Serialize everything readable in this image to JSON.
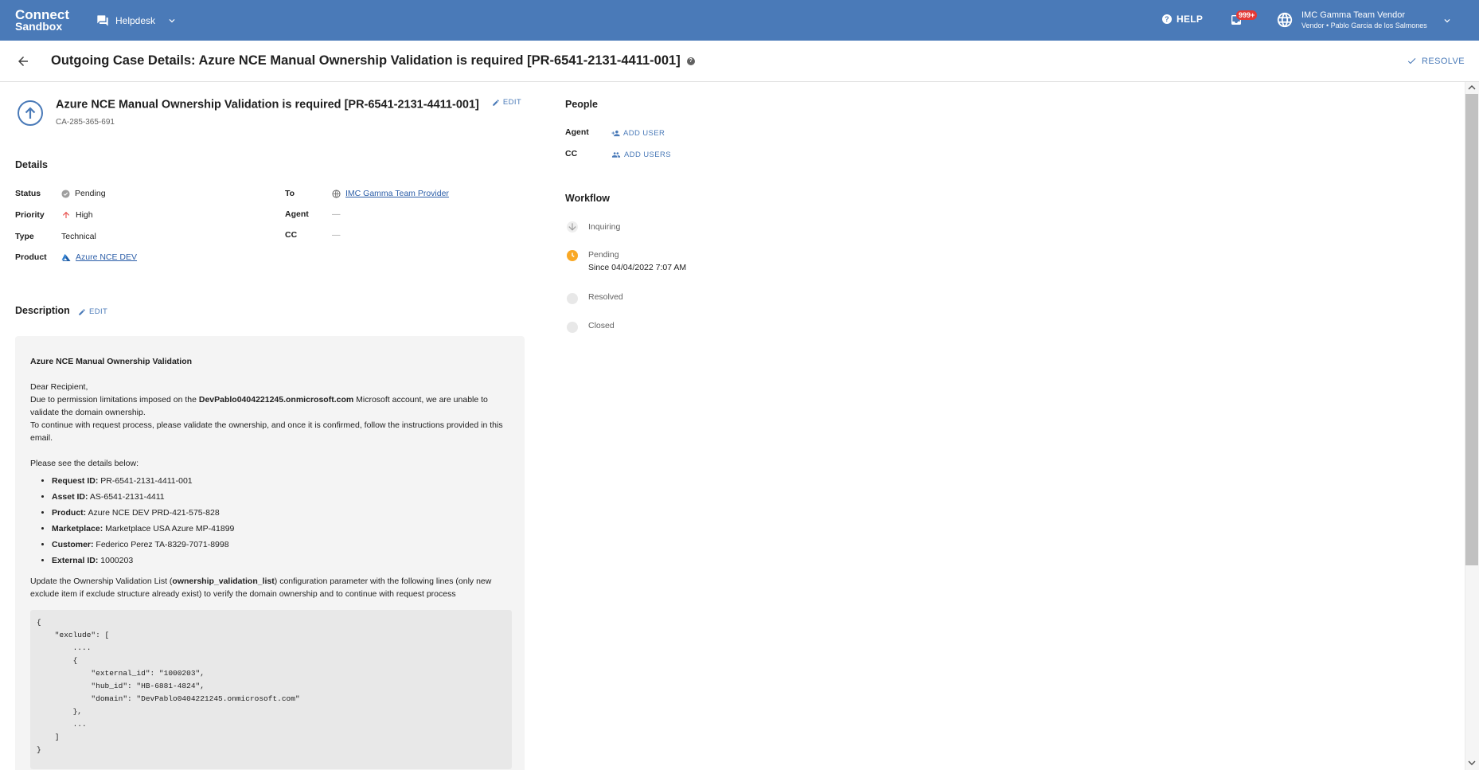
{
  "topbar": {
    "brand_line1": "Connect",
    "brand_line2": "Sandbox",
    "module": "Helpdesk",
    "help_label": "HELP",
    "notif_badge": "999+",
    "account_name": "IMC Gamma Team Vendor",
    "account_sub": "Vendor • Pablo Garcia de los Salmones",
    "color": "#4a7ab8"
  },
  "page": {
    "title": "Outgoing Case Details: Azure NCE Manual Ownership Validation is required [PR-6541-2131-4411-001]",
    "resolve_label": "RESOLVE"
  },
  "case": {
    "title": "Azure NCE Manual Ownership Validation is required [PR-6541-2131-4411-001]",
    "edit_label": "EDIT",
    "id": "CA-285-365-691"
  },
  "details": {
    "heading": "Details",
    "status_label": "Status",
    "status_value": "Pending",
    "priority_label": "Priority",
    "priority_value": "High",
    "type_label": "Type",
    "type_value": "Technical",
    "product_label": "Product",
    "product_value": "Azure NCE DEV",
    "to_label": "To",
    "to_value": "IMC Gamma Team Provider",
    "agent_label": "Agent",
    "agent_value": "—",
    "cc_label": "CC",
    "cc_value": "—"
  },
  "description": {
    "heading": "Description",
    "edit_label": "EDIT",
    "title": "Azure NCE Manual Ownership Validation",
    "greeting": "Dear Recipient,",
    "para1_a": "Due to permission limitations imposed on the ",
    "para1_bold": "DevPablo0404221245.onmicrosoft.com",
    "para1_b": " Microsoft account, we are unable to validate the domain ownership.",
    "para2": "To continue with request process, please validate the ownership, and once it is confirmed, follow the instructions provided in this email.",
    "para3": "Please see the details below:",
    "items": [
      {
        "label": "Request ID:",
        "value": " PR-6541-2131-4411-001"
      },
      {
        "label": "Asset ID:",
        "value": " AS-6541-2131-4411"
      },
      {
        "label": "Product:",
        "value": " Azure NCE DEV PRD-421-575-828"
      },
      {
        "label": "Marketplace:",
        "value": " Marketplace USA Azure MP-41899"
      },
      {
        "label": "Customer:",
        "value": " Federico Perez TA-8329-7071-8998"
      },
      {
        "label": "External ID:",
        "value": " 1000203"
      }
    ],
    "para4_a": "Update the Ownership Validation List (",
    "para4_bold": "ownership_validation_list",
    "para4_b": ") configuration parameter with the following lines (only new exclude item if exclude structure already exist) to verify the domain ownership and to continue with request process",
    "code": "{\n    \"exclude\": [\n        ....\n        {\n            \"external_id\": \"1000203\",\n            \"hub_id\": \"HB-6881-4824\",\n            \"domain\": \"DevPablo0404221245.onmicrosoft.com\"\n        },\n        ...\n    ]\n}"
  },
  "people": {
    "heading": "People",
    "agent_label": "Agent",
    "add_user": "ADD USER",
    "cc_label": "CC",
    "add_users": "ADD USERS"
  },
  "workflow": {
    "heading": "Workflow",
    "steps": [
      {
        "label": "Inquiring",
        "sub": ""
      },
      {
        "label": "Pending",
        "sub": "Since 04/04/2022 7:07 AM"
      },
      {
        "label": "Resolved",
        "sub": ""
      },
      {
        "label": "Closed",
        "sub": ""
      }
    ],
    "active_color": "#f9a825"
  }
}
